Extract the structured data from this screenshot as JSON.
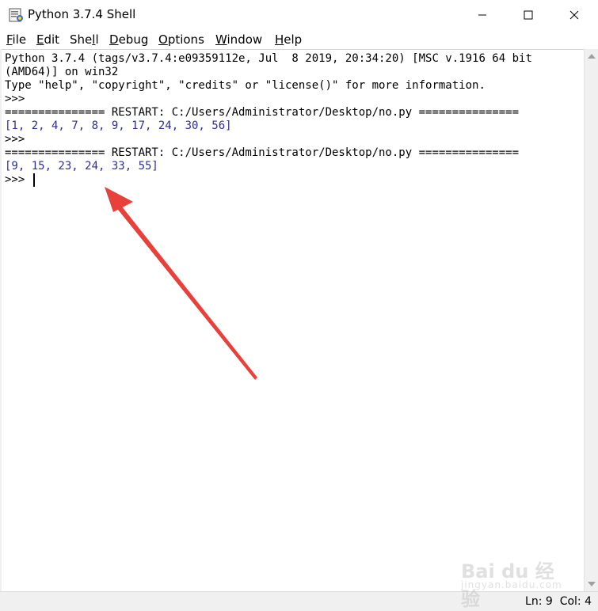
{
  "window": {
    "title": "Python 3.7.4 Shell",
    "app_icon": "python-idle-icon",
    "controls": {
      "minimize_icon": "minimize-icon",
      "maximize_icon": "maximize-icon",
      "close_icon": "close-icon"
    }
  },
  "menubar": {
    "items": [
      {
        "prefix": "",
        "mnemonic": "F",
        "rest": "ile"
      },
      {
        "prefix": "",
        "mnemonic": "E",
        "rest": "dit"
      },
      {
        "prefix": "She",
        "mnemonic": "l",
        "rest": "l"
      },
      {
        "prefix": "",
        "mnemonic": "D",
        "rest": "ebug"
      },
      {
        "prefix": "",
        "mnemonic": "O",
        "rest": "ptions"
      },
      {
        "prefix": "",
        "mnemonic": "W",
        "rest": "indow"
      },
      {
        "prefix": "",
        "mnemonic": "H",
        "rest": "elp"
      }
    ]
  },
  "shell": {
    "lines": [
      "Python 3.7.4 (tags/v3.7.4:e09359112e, Jul  8 2019, 20:34:20) [MSC v.1916 64 bit",
      "(AMD64)] on win32",
      "Type \"help\", \"copyright\", \"credits\" or \"license()\" for more information.",
      ">>>",
      "=============== RESTART: C:/Users/Administrator/Desktop/no.py ===============",
      "[1, 2, 4, 7, 8, 9, 17, 24, 30, 56]",
      ">>>",
      "=============== RESTART: C:/Users/Administrator/Desktop/no.py ===============",
      "[9, 15, 23, 24, 33, 55]",
      ">>>"
    ]
  },
  "statusbar": {
    "ln": "Ln: 9",
    "col": "Col: 4"
  },
  "watermark": {
    "brand": "Bai du 经验",
    "sub": "jingyan.baidu.com"
  },
  "colors": {
    "output": "#2d2d9e",
    "annotation_arrow": "#e8403a"
  }
}
